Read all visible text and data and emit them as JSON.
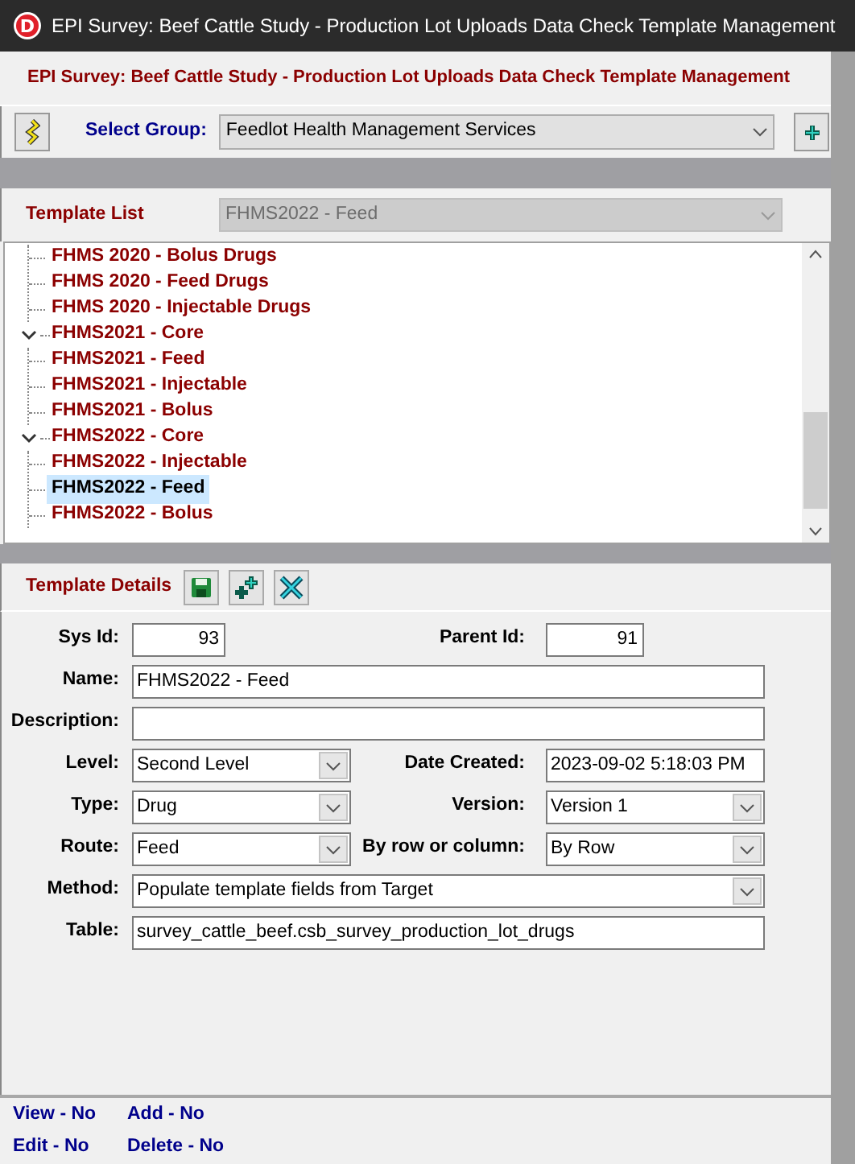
{
  "window": {
    "logo_letter": "D",
    "title": "EPI Survey: Beef Cattle Study - Production Lot Uploads Data Check Template Management"
  },
  "header": {
    "title": "EPI Survey: Beef Cattle Study - Production Lot Uploads Data Check Template Management"
  },
  "group_bar": {
    "label": "Select Group:",
    "value": "Feedlot Health Management Services"
  },
  "template_list": {
    "label": "Template List",
    "value": "FHMS2022 - Feed",
    "disabled": true
  },
  "tree": [
    {
      "children": [
        {
          "label": "FHMS 2020 - Bolus Drugs",
          "selected": false
        },
        {
          "label": "FHMS 2020 - Feed Drugs",
          "selected": false
        },
        {
          "label": "FHMS 2020 - Injectable Drugs",
          "selected": false
        }
      ]
    },
    {
      "label": "FHMS2021 - Core",
      "expanded": true,
      "children": [
        {
          "label": "FHMS2021 - Feed",
          "selected": false
        },
        {
          "label": "FHMS2021 - Injectable",
          "selected": false
        },
        {
          "label": "FHMS2021 - Bolus",
          "selected": false
        }
      ]
    },
    {
      "label": "FHMS2022 - Core",
      "expanded": true,
      "children": [
        {
          "label": "FHMS2022 - Injectable",
          "selected": false
        },
        {
          "label": "FHMS2022 - Feed",
          "selected": true
        },
        {
          "label": "FHMS2022 - Bolus",
          "selected": false
        }
      ]
    }
  ],
  "details": {
    "title": "Template Details",
    "rows": [
      [
        {
          "kind": "number",
          "label": "Sys Id:",
          "value": "93"
        },
        {
          "kind": "number",
          "label": "Parent Id:",
          "value": "91"
        }
      ],
      [
        {
          "kind": "text",
          "label": "Name:",
          "value": "FHMS2022 - Feed"
        }
      ],
      [
        {
          "kind": "text",
          "label": "Description:"
        }
      ],
      [
        {
          "kind": "select",
          "label": "Level:",
          "value": "Second Level"
        },
        {
          "kind": "text",
          "label": "Date Created:",
          "value": "2023-09-02 5:18:03 PM"
        }
      ],
      [
        {
          "kind": "select",
          "label": "Type:",
          "value": "Drug"
        },
        {
          "kind": "select",
          "label": "Version:",
          "value": "Version 1"
        }
      ],
      [
        {
          "kind": "select",
          "label": "Route:",
          "value": "Feed"
        },
        {
          "kind": "select",
          "label": "By row or column:",
          "value": "By Row"
        }
      ],
      [
        {
          "kind": "select",
          "label": "Method:",
          "value": "Populate template fields from Target"
        }
      ],
      [
        {
          "kind": "text",
          "label": "Table:",
          "value": "survey_cattle_beef.csb_survey_production_lot_drugs"
        }
      ]
    ]
  },
  "permissions": [
    {
      "text": "View - No"
    },
    {
      "text": "Add - No"
    },
    {
      "text": "Edit - No"
    },
    {
      "text": "Delete - No"
    }
  ]
}
